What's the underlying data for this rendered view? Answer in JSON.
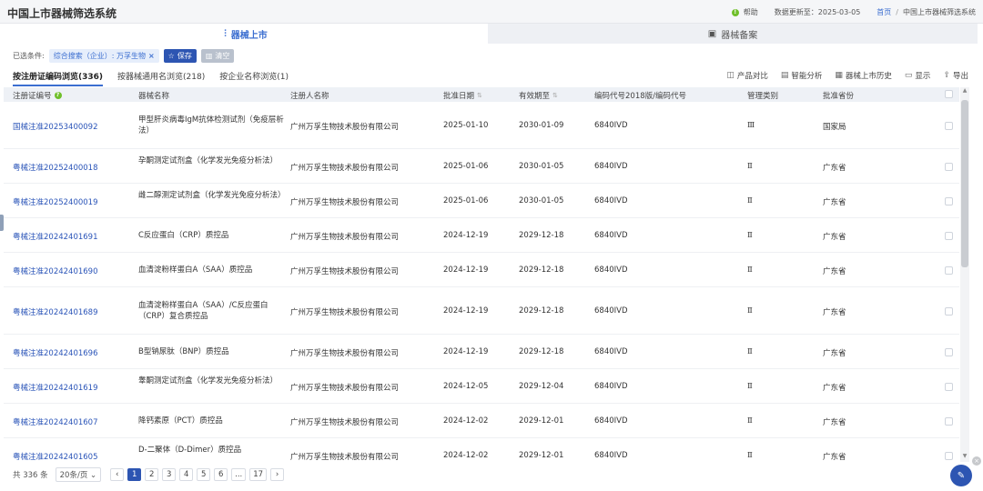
{
  "header": {
    "title": "中国上市器械筛选系统",
    "help_label": "帮助",
    "update_label": "数据更新至：2025-03-05",
    "breadcrumb_home": "首页",
    "breadcrumb_current": "中国上市器械筛选系统"
  },
  "tabs": {
    "listed": "器械上市",
    "filed": "器械备案"
  },
  "filter": {
    "label": "已选条件:",
    "chip": "综合搜索（企业）: 万孚生物",
    "save": "保存",
    "clear": "清空"
  },
  "subtabs": [
    {
      "label": "按注册证编码浏览(336)"
    },
    {
      "label": "按器械通用名浏览(218)"
    },
    {
      "label": "按企业名称浏览(1)"
    }
  ],
  "tools": [
    {
      "label": "产品对比",
      "icon": "compare-icon",
      "glyph": "◫"
    },
    {
      "label": "智能分析",
      "icon": "analysis-icon",
      "glyph": "▤"
    },
    {
      "label": "器械上市历史",
      "icon": "history-icon",
      "glyph": "▦"
    },
    {
      "label": "显示",
      "icon": "display-icon",
      "glyph": "▭"
    },
    {
      "label": "导出",
      "icon": "export-icon",
      "glyph": "⇪"
    }
  ],
  "columns": {
    "reg_no": "注册证编号",
    "name": "器械名称",
    "registrant": "注册人名称",
    "approval_date": "批准日期",
    "valid_until": "有效期至",
    "code": "编码代号2018版/编码代号",
    "class": "管理类别",
    "province": "批准省份"
  },
  "rows": [
    {
      "reg_no": "国械注准20253400092",
      "name": "甲型肝炎病毒IgM抗体检测试剂（免疫层析法）",
      "registrant": "广州万孚生物技术股份有限公司",
      "approval_date": "2025-01-10",
      "valid_until": "2030-01-09",
      "code": "6840IVD",
      "class": "Ⅲ",
      "province": "国家局"
    },
    {
      "reg_no": "粤械注准20252400018",
      "name": "孕酮测定试剂盒（化学发光免疫分析法）",
      "registrant": "广州万孚生物技术股份有限公司",
      "approval_date": "2025-01-06",
      "valid_until": "2030-01-05",
      "code": "6840IVD",
      "class": "Ⅱ",
      "province": "广东省"
    },
    {
      "reg_no": "粤械注准20252400019",
      "name": "雌二醇测定试剂盒（化学发光免疫分析法）",
      "registrant": "广州万孚生物技术股份有限公司",
      "approval_date": "2025-01-06",
      "valid_until": "2030-01-05",
      "code": "6840IVD",
      "class": "Ⅱ",
      "province": "广东省"
    },
    {
      "reg_no": "粤械注准20242401691",
      "name": "C反应蛋白（CRP）质控品",
      "registrant": "广州万孚生物技术股份有限公司",
      "approval_date": "2024-12-19",
      "valid_until": "2029-12-18",
      "code": "6840IVD",
      "class": "Ⅱ",
      "province": "广东省"
    },
    {
      "reg_no": "粤械注准20242401690",
      "name": "血清淀粉样蛋白A（SAA）质控品",
      "registrant": "广州万孚生物技术股份有限公司",
      "approval_date": "2024-12-19",
      "valid_until": "2029-12-18",
      "code": "6840IVD",
      "class": "Ⅱ",
      "province": "广东省"
    },
    {
      "reg_no": "粤械注准20242401689",
      "name": "血清淀粉样蛋白A（SAA）/C反应蛋白（CRP）复合质控品",
      "registrant": "广州万孚生物技术股份有限公司",
      "approval_date": "2024-12-19",
      "valid_until": "2029-12-18",
      "code": "6840IVD",
      "class": "Ⅱ",
      "province": "广东省"
    },
    {
      "reg_no": "粤械注准20242401696",
      "name": "B型钠尿肽（BNP）质控品",
      "registrant": "广州万孚生物技术股份有限公司",
      "approval_date": "2024-12-19",
      "valid_until": "2029-12-18",
      "code": "6840IVD",
      "class": "Ⅱ",
      "province": "广东省"
    },
    {
      "reg_no": "粤械注准20242401619",
      "name": "睾酮测定试剂盒（化学发光免疫分析法）",
      "registrant": "广州万孚生物技术股份有限公司",
      "approval_date": "2024-12-05",
      "valid_until": "2029-12-04",
      "code": "6840IVD",
      "class": "Ⅱ",
      "province": "广东省"
    },
    {
      "reg_no": "粤械注准20242401607",
      "name": "降钙素原（PCT）质控品",
      "registrant": "广州万孚生物技术股份有限公司",
      "approval_date": "2024-12-02",
      "valid_until": "2029-12-01",
      "code": "6840IVD",
      "class": "Ⅱ",
      "province": "广东省"
    },
    {
      "reg_no": "粤械注准20242401605",
      "name": "D-二聚体（D-Dimer）质控品",
      "registrant": "广州万孚生物技术股份有限公司",
      "approval_date": "2024-12-02",
      "valid_until": "2029-12-01",
      "code": "6840IVD",
      "class": "Ⅱ",
      "province": "广东省"
    }
  ],
  "pager": {
    "total": "共 336 条",
    "page_size": "20条/页",
    "pages": [
      "1",
      "2",
      "3",
      "4",
      "5",
      "6",
      "...",
      "17"
    ],
    "current": "1"
  }
}
